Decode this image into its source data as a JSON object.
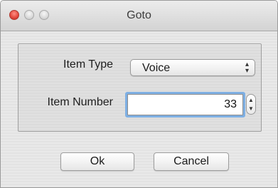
{
  "window": {
    "title": "Goto"
  },
  "form": {
    "item_type_label": "Item Type",
    "item_type_value": "Voice",
    "item_number_label": "Item Number",
    "item_number_value": "33"
  },
  "buttons": {
    "ok_label": "Ok",
    "cancel_label": "Cancel"
  },
  "icons": {
    "popup_arrows": "up-down-arrows-icon",
    "stepper": "stepper-arrows-icon"
  },
  "colors": {
    "close_button": "#e2463b",
    "focus_ring": "#5fa0e6"
  }
}
